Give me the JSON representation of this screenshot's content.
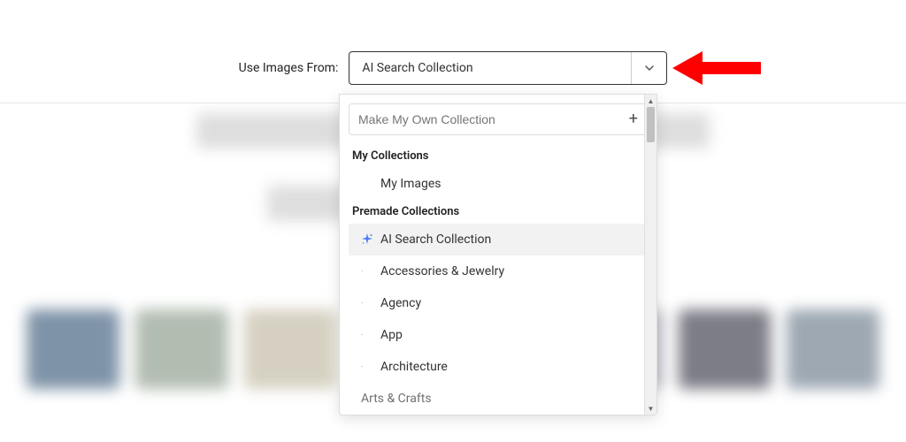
{
  "label": "Use Images From:",
  "selected_value": "AI Search Collection",
  "make_own_placeholder": "Make My Own Collection",
  "sections": {
    "my_collections": {
      "header": "My Collections",
      "items": [
        "My Images"
      ]
    },
    "premade": {
      "header": "Premade Collections",
      "items": [
        {
          "label": "AI Search Collection",
          "selected": true,
          "icon": "sparkle"
        },
        {
          "label": "Accessories & Jewelry",
          "selected": false
        },
        {
          "label": "Agency",
          "selected": false
        },
        {
          "label": "App",
          "selected": false
        },
        {
          "label": "Architecture",
          "selected": false
        },
        {
          "label": "Arts & Crafts",
          "selected": false
        }
      ]
    }
  }
}
